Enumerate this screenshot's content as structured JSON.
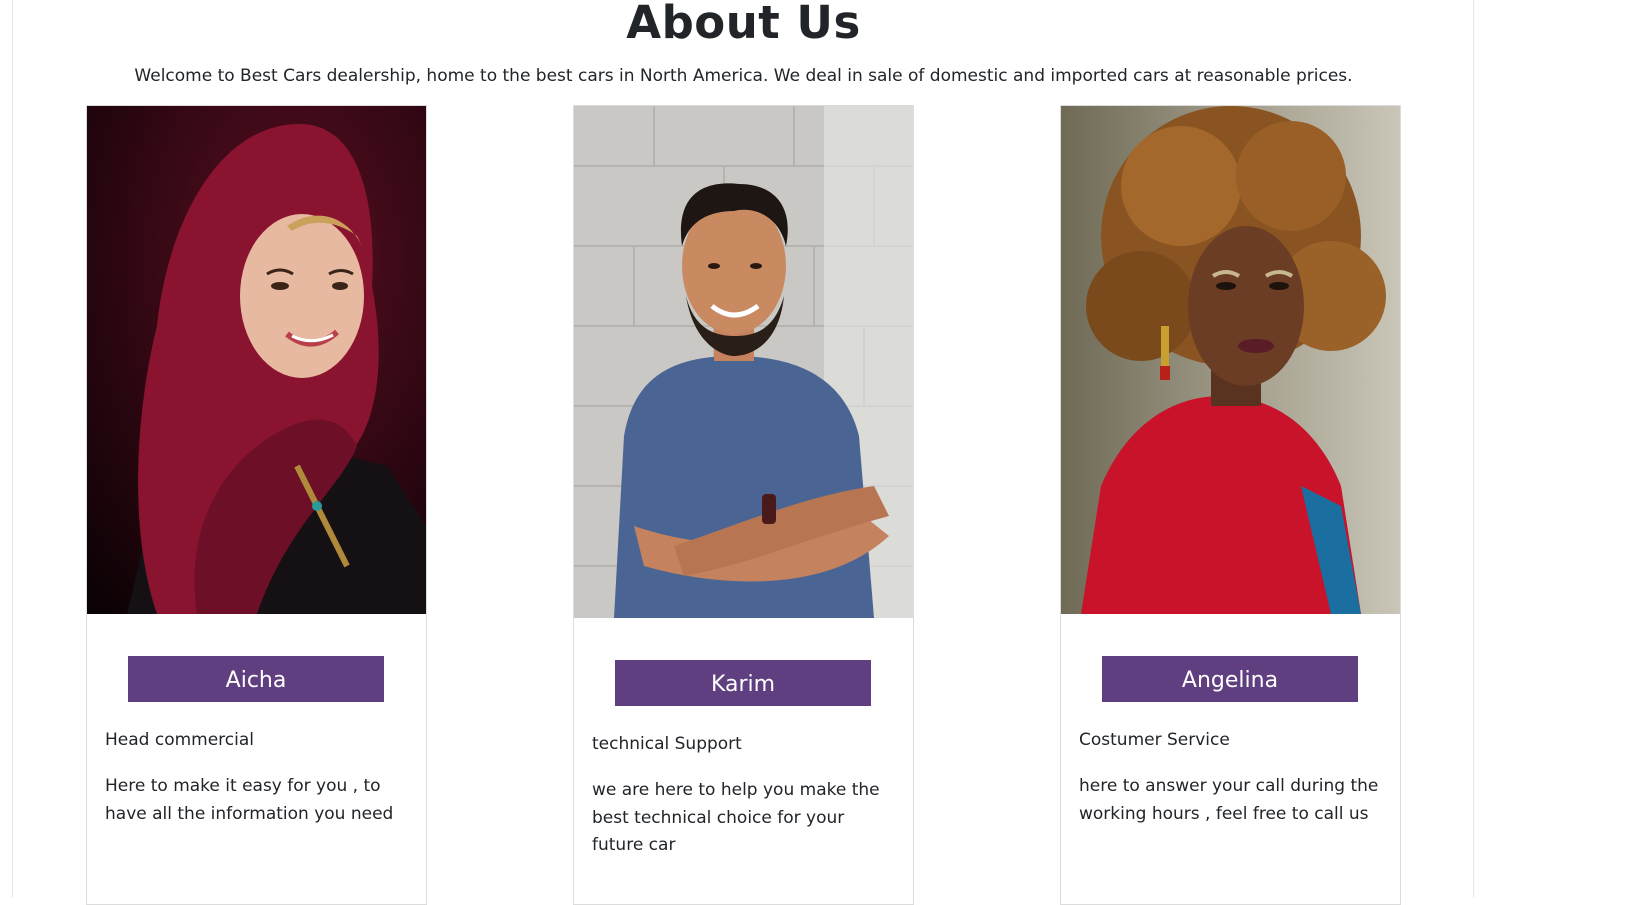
{
  "header": {
    "title": "About Us",
    "intro": "Welcome to Best Cars dealership, home to the best cars in North America. We deal in sale of domestic and imported cars at reasonable prices."
  },
  "team": [
    {
      "name": "Aicha",
      "role": "Head commercial",
      "description": "Here to make it easy for you , to have all the information you need",
      "photo": "portrait-woman-red-hijab"
    },
    {
      "name": "Karim",
      "role": "technical Support",
      "description": "we are here to help you make the best technical choice for your future car",
      "photo": "portrait-man-blue-tshirt"
    },
    {
      "name": "Angelina",
      "role": "Costumer Service",
      "description": "here to answer your call during the working hours , feel free to call us",
      "photo": "portrait-woman-curly-hair-red-jacket"
    }
  ],
  "colors": {
    "button_bg": "#5f3f80",
    "button_text": "#ffffff",
    "text": "#212529",
    "border": "#dcdcdc"
  }
}
